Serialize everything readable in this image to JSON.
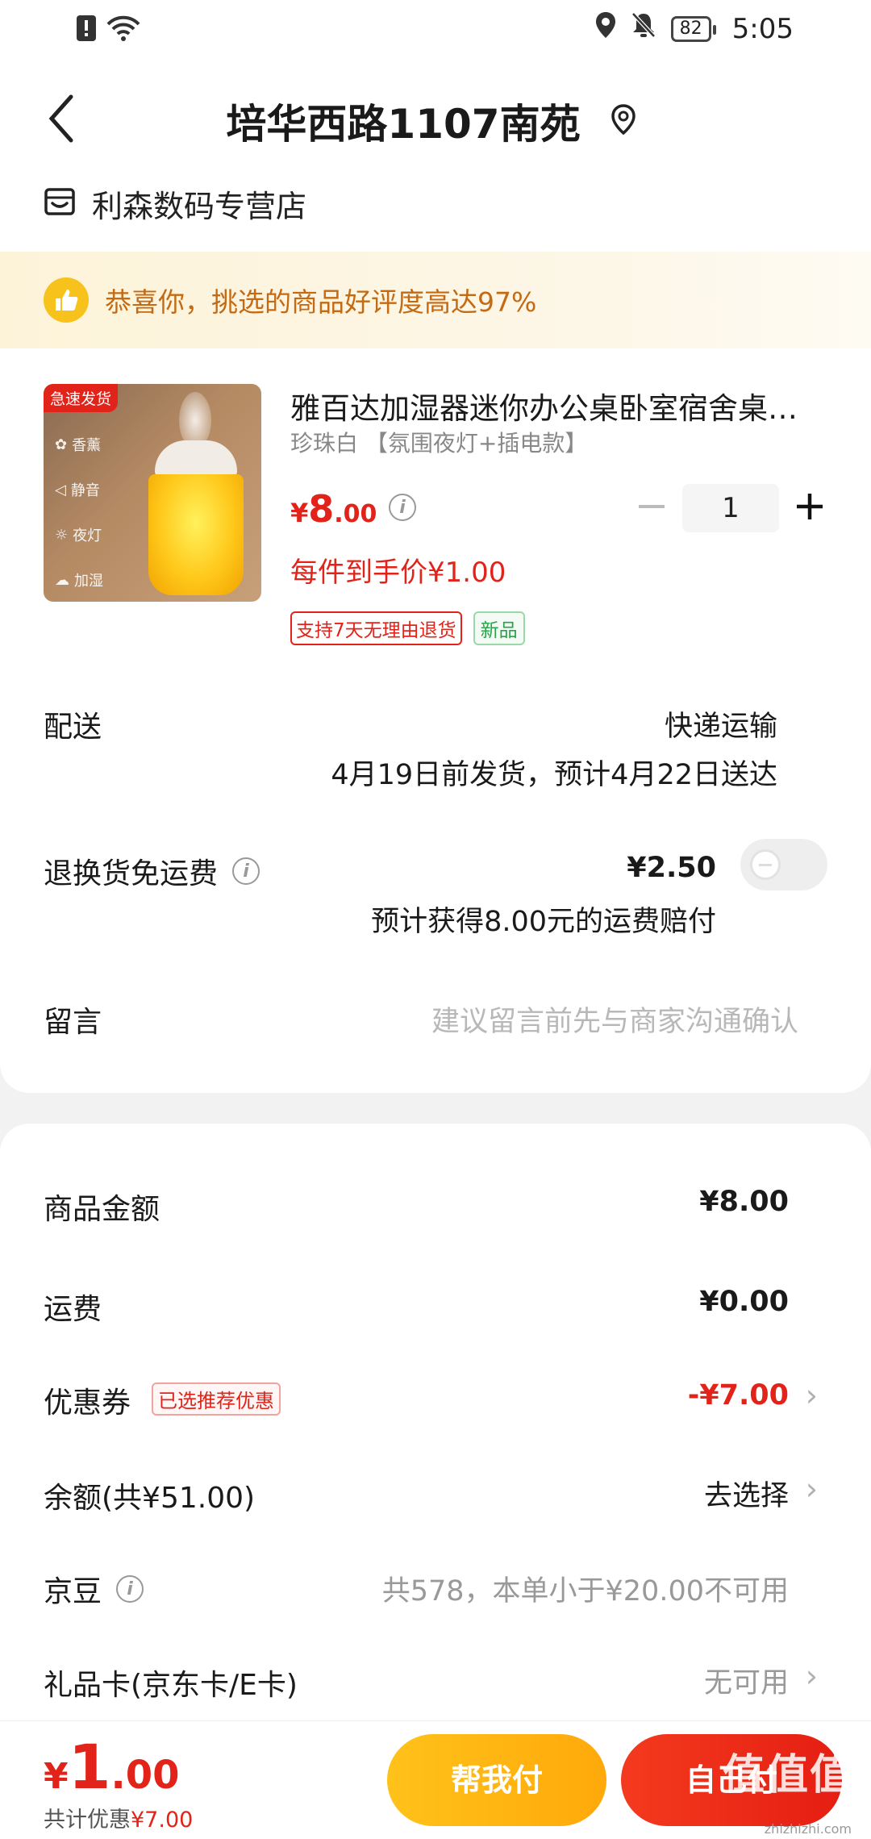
{
  "status_bar": {
    "battery": "82",
    "time": "5:05"
  },
  "header": {
    "title": "培华西路1107南苑"
  },
  "shop": {
    "name": "利森数码专营店"
  },
  "praise_banner": {
    "text": "恭喜你，挑选的商品好评度高达97%"
  },
  "product": {
    "badge": "急速发货",
    "image_features": [
      "香薰",
      "静音",
      "夜灯",
      "加湿"
    ],
    "title": "雅百达加湿器迷你办公桌卧室宿舍桌…",
    "spec": "珍珠白 【氛围夜灯+插电款】",
    "price_currency": "¥",
    "price_int": "8",
    "price_dec": ".00",
    "quantity": "1",
    "each_price": "每件到手价¥1.00",
    "tags": [
      "支持7天无理由退货",
      "新品"
    ]
  },
  "delivery": {
    "label": "配送",
    "method": "快递运输",
    "schedule": "4月19日前发货，预计4月22日送达"
  },
  "return_shipping": {
    "label": "退换货免运费",
    "price": "¥2.50",
    "note": "预计获得8.00元的运费赔付"
  },
  "message": {
    "label": "留言",
    "placeholder": "建议留言前先与商家沟通确认"
  },
  "summary": {
    "goods_label": "商品金额",
    "goods_value": "¥8.00",
    "shipping_label": "运费",
    "shipping_value": "¥0.00",
    "coupon_label": "优惠券",
    "coupon_tag": "已选推荐优惠",
    "coupon_value": "-¥7.00",
    "balance_label": "余额(共¥51.00)",
    "balance_value": "去选择",
    "jingdou_label": "京豆",
    "jingdou_value": "共578，本单小于¥20.00不可用",
    "giftcard_label": "礼品卡(京东卡/E卡)",
    "giftcard_value": "无可用"
  },
  "bottom_bar": {
    "total_currency": "¥",
    "total_int": "1",
    "total_dec": ".00",
    "discount_prefix": "共计优惠",
    "discount_value": "¥7.00",
    "help_pay_label": "帮我付",
    "self_pay_label": "自己付",
    "watermark": "值值值",
    "watermark_url": "zhizhizhi.com"
  },
  "colors": {
    "accent_red": "#e2231a",
    "banner_text": "#c46a13",
    "help_button": "#ffb30f"
  }
}
